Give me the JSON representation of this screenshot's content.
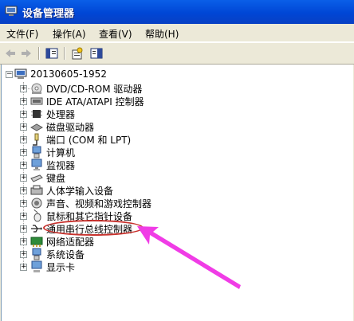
{
  "window": {
    "title": "设备管理器"
  },
  "menu": [
    {
      "label": "文件(F)"
    },
    {
      "label": "操作(A)"
    },
    {
      "label": "查看(V)"
    },
    {
      "label": "帮助(H)"
    }
  ],
  "toolbar": {
    "icons": [
      "back-arrow-icon",
      "forward-arrow-icon",
      "console-tree-icon",
      "properties-icon",
      "help-view-icon"
    ]
  },
  "tree": {
    "root": {
      "label": "20130605-1952",
      "expander": "−"
    },
    "items": [
      {
        "label": "DVD/CD-ROM 驱动器",
        "icon": "dvd-drive-icon"
      },
      {
        "label": "IDE ATA/ATAPI 控制器",
        "icon": "ide-controller-icon"
      },
      {
        "label": "处理器",
        "icon": "processor-icon"
      },
      {
        "label": "磁盘驱动器",
        "icon": "disk-drive-icon"
      },
      {
        "label": "端口 (COM 和 LPT)",
        "icon": "port-icon"
      },
      {
        "label": "计算机",
        "icon": "computer-icon"
      },
      {
        "label": "监视器",
        "icon": "monitor-icon"
      },
      {
        "label": "键盘",
        "icon": "keyboard-icon"
      },
      {
        "label": "人体学输入设备",
        "icon": "hid-icon"
      },
      {
        "label": "声音、视频和游戏控制器",
        "icon": "sound-icon"
      },
      {
        "label": "鼠标和其它指针设备",
        "icon": "mouse-icon"
      },
      {
        "label": "通用串行总线控制器",
        "icon": "usb-icon"
      },
      {
        "label": "网络适配器",
        "icon": "network-adapter-icon"
      },
      {
        "label": "系统设备",
        "icon": "system-device-icon"
      },
      {
        "label": "显示卡",
        "icon": "display-adapter-icon"
      }
    ],
    "expander": "+"
  },
  "colors": {
    "title_bar": "#0054E3",
    "annotation": "#C8322D",
    "arrow": "#F03CE6"
  }
}
